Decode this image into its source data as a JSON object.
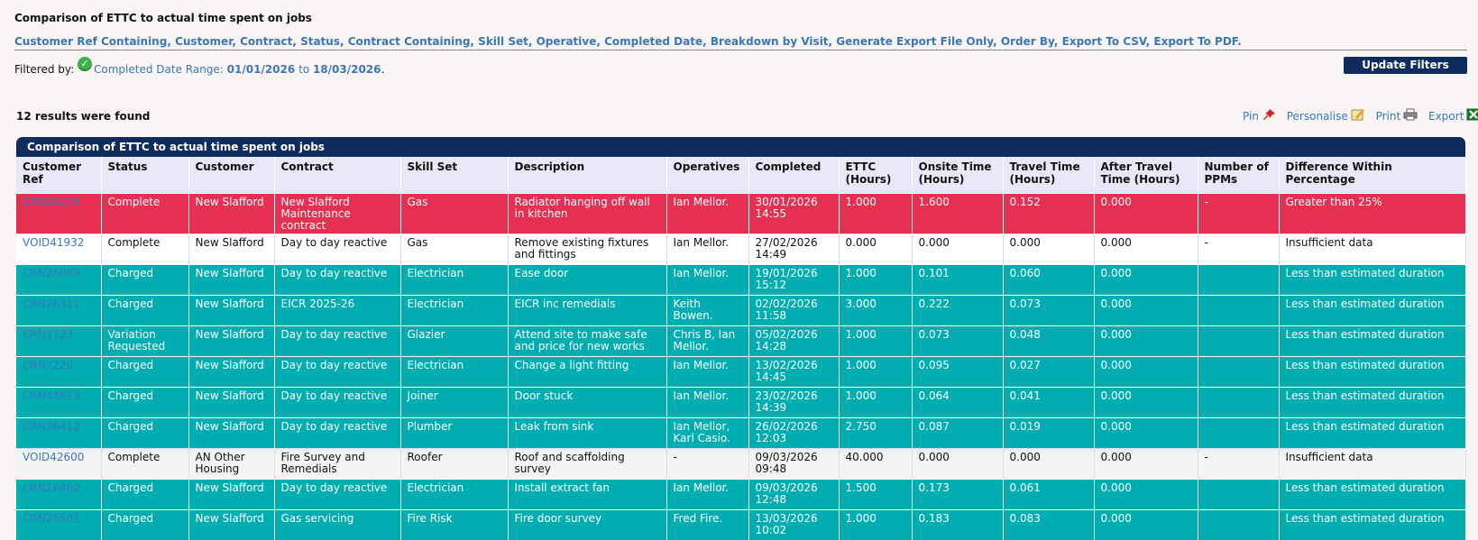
{
  "page": {
    "title": "Comparison of ETTC to actual time spent on jobs"
  },
  "filter_links": [
    "Customer Ref Containing",
    "Customer",
    "Contract",
    "Status",
    "Contract Containing",
    "Skill Set",
    "Operative",
    "Completed Date",
    "Breakdown by Visit",
    "Generate Export File Only",
    "Order By",
    "Export To CSV",
    "Export To PDF"
  ],
  "filtered_by": {
    "prefix": "Filtered by:",
    "label": "Completed Date Range:",
    "from": "01/01/2026",
    "to_word": "to",
    "to": "18/03/2026",
    "suffix": "."
  },
  "update_button": "Update Filters",
  "results_text": "12 results were found",
  "tools": {
    "pin": "Pin",
    "personalise": "Personalise",
    "print": "Print",
    "export": "Export"
  },
  "table": {
    "title": "Comparison of ETTC to actual time spent on jobs",
    "columns": [
      "Customer Ref",
      "Status",
      "Customer",
      "Contract",
      "Skill Set",
      "Description",
      "Operatives",
      "Completed",
      "ETTC (Hours)",
      "Onsite Time (Hours)",
      "Travel Time (Hours)",
      "After Travel Time (Hours)",
      "Number of PPMs",
      "Difference Within Percentage"
    ],
    "rows": [
      {
        "style": "red",
        "ref": "CRN26276",
        "status": "Complete",
        "customer": "New Slafford",
        "contract": "New Slafford Maintenance contract",
        "skill": "Gas",
        "description": "Radiator hanging off wall in kitchen",
        "operatives": "Ian Mellor.",
        "completed": "30/01/2026 14:55",
        "ettc": "1.000",
        "onsite": "1.600",
        "travel": "0.152",
        "after": "0.000",
        "ppms": "-",
        "diff": "Greater than 25%"
      },
      {
        "style": "white",
        "ref": "VOID41932",
        "status": "Complete",
        "customer": "New Slafford",
        "contract": "Day to day reactive",
        "skill": "Gas",
        "description": "Remove existing fixtures and fittings",
        "operatives": "Ian Mellor.",
        "completed": "27/02/2026 14:49",
        "ettc": "0.000",
        "onsite": "0.000",
        "travel": "0.000",
        "after": "0.000",
        "ppms": "-",
        "diff": "Insufficient data"
      },
      {
        "style": "teal",
        "ref": "CRN26089",
        "status": "Charged",
        "customer": "New Slafford",
        "contract": "Day to day reactive",
        "skill": "Electrician",
        "description": "Ease door",
        "operatives": "Ian Mellor.",
        "completed": "19/01/2026 15:12",
        "ettc": "1.000",
        "onsite": "0.101",
        "travel": "0.060",
        "after": "0.000",
        "ppms": "",
        "diff": "Less than estimated duration"
      },
      {
        "style": "teal",
        "ref": "CRN26311",
        "status": "Charged",
        "customer": "New Slafford",
        "contract": "EICR 2025-26",
        "skill": "Electrician",
        "description": "EICR inc remedials",
        "operatives": "Keith Bowen.",
        "completed": "02/02/2026 11:58",
        "ettc": "3.000",
        "onsite": "0.222",
        "travel": "0.073",
        "after": "0.000",
        "ppms": "",
        "diff": "Less than estimated duration"
      },
      {
        "style": "teal",
        "ref": "CRN7123",
        "status": "Variation Requested",
        "customer": "New Slafford",
        "contract": "Day to day reactive",
        "skill": "Glazier",
        "description": "Attend site to make safe and price for new works",
        "operatives": "Chris B, Ian Mellor.",
        "completed": "05/02/2026 14:28",
        "ettc": "1.000",
        "onsite": "0.073",
        "travel": "0.048",
        "after": "0.000",
        "ppms": "",
        "diff": "Less than estimated duration"
      },
      {
        "style": "teal",
        "ref": "CRN7220",
        "status": "Charged",
        "customer": "New Slafford",
        "contract": "Day to day reactive",
        "skill": "Electrician",
        "description": "Change a light fitting",
        "operatives": "Ian Mellor.",
        "completed": "13/02/2026 14:45",
        "ettc": "1.000",
        "onsite": "0.095",
        "travel": "0.027",
        "after": "0.000",
        "ppms": "",
        "diff": "Less than estimated duration"
      },
      {
        "style": "teal",
        "ref": "CRN41613",
        "status": "Charged",
        "customer": "New Slafford",
        "contract": "Day to day reactive",
        "skill": "Joiner",
        "description": "Door stuck",
        "operatives": "Ian Mellor.",
        "completed": "23/02/2026 14:39",
        "ettc": "1.000",
        "onsite": "0.064",
        "travel": "0.041",
        "after": "0.000",
        "ppms": "",
        "diff": "Less than estimated duration"
      },
      {
        "style": "teal",
        "ref": "CRN26412",
        "status": "Charged",
        "customer": "New Slafford",
        "contract": "Day to day reactive",
        "skill": "Plumber",
        "description": "Leak from sink",
        "operatives": "Ian Mellor, Karl Casio.",
        "completed": "26/02/2026 12:03",
        "ettc": "2.750",
        "onsite": "0.087",
        "travel": "0.019",
        "after": "0.000",
        "ppms": "",
        "diff": "Less than estimated duration"
      },
      {
        "style": "grey",
        "ref": "VOID42600",
        "status": "Complete",
        "customer": "AN Other Housing",
        "contract": "Fire Survey and Remedials",
        "skill": "Roofer",
        "description": "Roof and scaffolding survey",
        "operatives": "-",
        "completed": "09/03/2026 09:48",
        "ettc": "40.000",
        "onsite": "0.000",
        "travel": "0.000",
        "after": "0.000",
        "ppms": "-",
        "diff": "Insufficient data"
      },
      {
        "style": "teal",
        "ref": "CRN26462",
        "status": "Charged",
        "customer": "New Slafford",
        "contract": "Day to day reactive",
        "skill": "Electrician",
        "description": "Install extract fan",
        "operatives": "Ian Mellor.",
        "completed": "09/03/2026 12:48",
        "ettc": "1.500",
        "onsite": "0.173",
        "travel": "0.061",
        "after": "0.000",
        "ppms": "",
        "diff": "Less than estimated duration"
      },
      {
        "style": "teal",
        "ref": "CRN26501",
        "status": "Charged",
        "customer": "New Slafford",
        "contract": "Gas servicing",
        "skill": "Fire Risk",
        "description": "Fire door survey",
        "operatives": "Fred Fire.",
        "completed": "13/03/2026 10:02",
        "ettc": "1.000",
        "onsite": "0.183",
        "travel": "0.083",
        "after": "0.000",
        "ppms": "",
        "diff": "Less than estimated duration"
      }
    ]
  }
}
